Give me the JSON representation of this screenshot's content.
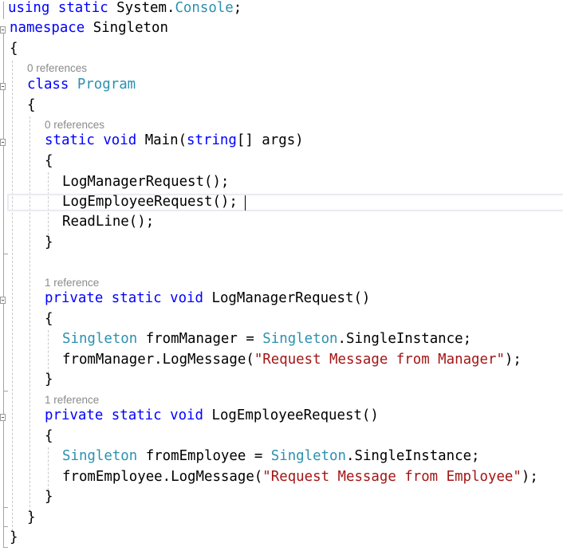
{
  "editor": {
    "language": "csharp",
    "lines": {
      "l1": {
        "using": "using",
        "static": "static",
        "ns": "System.",
        "console": "Console",
        ";": ";"
      },
      "l2": {
        "namespace": "namespace",
        "name": "Singleton"
      },
      "l3": {
        "brace": "{"
      },
      "ref_program": "0 references",
      "l4": {
        "class": "class",
        "name": "Program"
      },
      "l5": {
        "brace": "{"
      },
      "ref_main": "0 references",
      "l6": {
        "static": "static",
        "void": "void",
        "name": "Main(",
        "string": "string",
        "rest": "[] args)"
      },
      "l7": {
        "brace": "{"
      },
      "l8": "LogManagerRequest();",
      "l9": "LogEmployeeRequest();",
      "l10": "ReadLine();",
      "l11": {
        "brace": "}"
      },
      "ref_manager": "1 reference",
      "l12": {
        "private": "private",
        "static": "static",
        "void": "void",
        "name": "LogManagerRequest()"
      },
      "l13": {
        "brace": "{"
      },
      "l14": {
        "type": "Singleton",
        "var": " fromManager = ",
        "type2": "Singleton",
        "rest": ".SingleInstance;"
      },
      "l15": {
        "call": "fromManager.LogMessage(",
        "str": "\"Request Message from Manager\"",
        "end": ");"
      },
      "l16": {
        "brace": "}"
      },
      "ref_employee": "1 reference",
      "l17": {
        "private": "private",
        "static": "static",
        "void": "void",
        "name": "LogEmployeeRequest()"
      },
      "l18": {
        "brace": "{"
      },
      "l19": {
        "type": "Singleton",
        "var": " fromEmployee = ",
        "type2": "Singleton",
        "rest": ".SingleInstance;"
      },
      "l20": {
        "call": "fromEmployee.LogMessage(",
        "str": "\"Request Message from Employee\"",
        "end": ");"
      },
      "l21": {
        "brace": "}"
      },
      "l22": {
        "brace": "}"
      },
      "l23": {
        "brace": "}"
      }
    },
    "colors": {
      "keyword": "#0000ff",
      "type": "#2b91af",
      "string": "#a31515",
      "reference_hint": "#8a8a8a"
    }
  }
}
